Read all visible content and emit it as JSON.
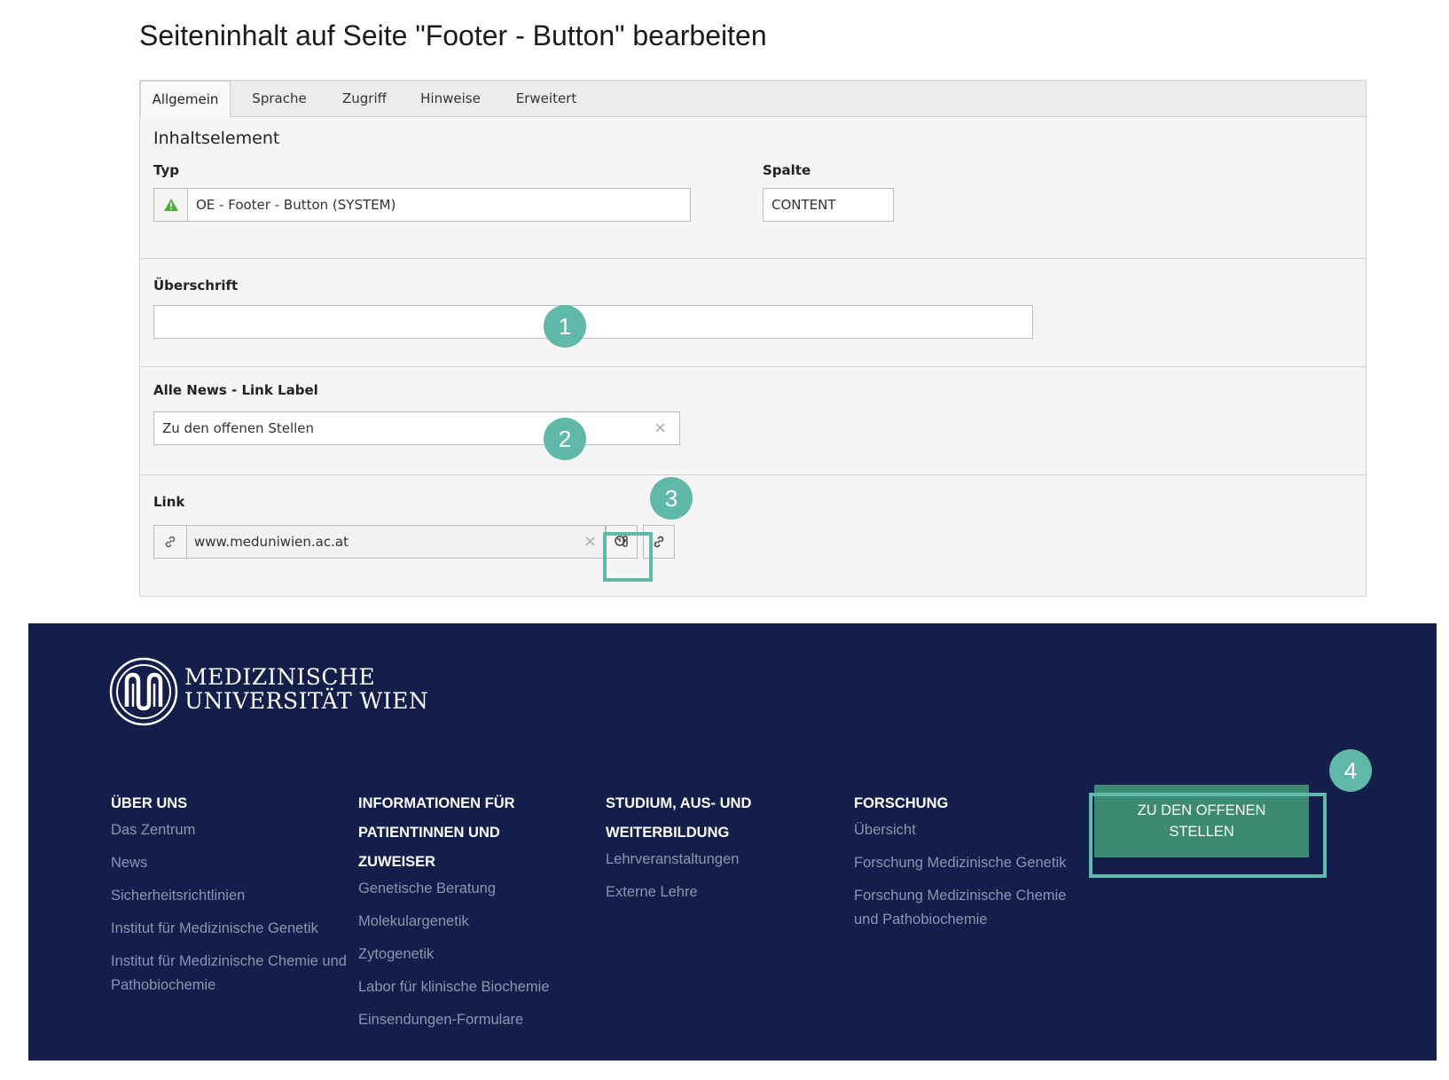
{
  "page_title": "Seiteninhalt auf Seite \"Footer - Button\" bearbeiten",
  "tabs": [
    {
      "label": "Allgemein",
      "active": true
    },
    {
      "label": "Sprache"
    },
    {
      "label": "Zugriff"
    },
    {
      "label": "Hinweise"
    },
    {
      "label": "Erweitert"
    }
  ],
  "content_element": {
    "heading": "Inhaltselement",
    "type_label": "Typ",
    "type_value": "OE - Footer - Button (SYSTEM)",
    "type_icon": "warning-triangle-icon",
    "column_label": "Spalte",
    "column_value": "CONTENT"
  },
  "heading_field": {
    "label": "Überschrift",
    "value": ""
  },
  "link_label_field": {
    "label": "Alle News - Link Label",
    "value": "Zu den offenen Stellen",
    "clear": "×"
  },
  "link_field": {
    "label": "Link",
    "value": "www.meduniwien.ac.at",
    "clear": "×",
    "icons": [
      "link-icon",
      "page-browser-icon",
      "link-icon"
    ]
  },
  "callouts": [
    "1",
    "2",
    "3",
    "4"
  ],
  "accent_color": "#5fb8a8",
  "footer": {
    "background": "#141e4a",
    "logo_line1": "MEDIZINISCHE",
    "logo_line2": "UNIVERSITÄT WIEN",
    "columns": [
      {
        "heading": "ÜBER UNS",
        "links": [
          "Das Zentrum",
          "News",
          "Sicherheitsrichtlinien",
          "Institut für Medizinische Genetik",
          "Institut für Medizinische Chemie und Pathobiochemie"
        ]
      },
      {
        "heading": "INFORMATIONEN FÜR PATIENTINNEN UND ZUWEISER",
        "links": [
          "Genetische Beratung",
          "Molekulargenetik",
          "Zytogenetik",
          "Labor für klinische Biochemie",
          "Einsendungen-Formulare"
        ]
      },
      {
        "heading": "STUDIUM, AUS- UND WEITERBILDUNG",
        "links": [
          "Lehrveranstaltungen",
          "Externe Lehre"
        ]
      },
      {
        "heading": "FORSCHUNG",
        "links": [
          "Übersicht",
          "Forschung Medizinische Genetik",
          "Forschung Medizinische Chemie und Pathobiochemie"
        ]
      }
    ],
    "cta_label": "ZU DEN OFFENEN STELLEN",
    "cta_color": "#3d8a73"
  }
}
